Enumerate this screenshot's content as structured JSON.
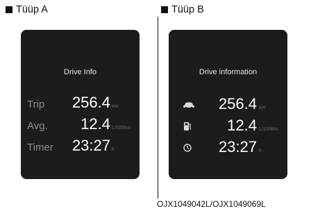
{
  "sections": {
    "a": {
      "title": "Tüüp A"
    },
    "b": {
      "title": "Tüüp B"
    }
  },
  "screen_a": {
    "title": "Drive Info",
    "rows": [
      {
        "label": "Trip",
        "value": "256.4",
        "unit": "km"
      },
      {
        "label": "Avg.",
        "value": "12.4",
        "unit": "L/100km"
      },
      {
        "label": "Timer",
        "value": "23:27",
        "unit": "h"
      }
    ]
  },
  "screen_b": {
    "title": "Drive information",
    "rows": [
      {
        "icon": "car-icon",
        "value": "256.4",
        "unit": "km"
      },
      {
        "icon": "fuel-pump-icon",
        "value": "12.4",
        "unit": "L/100km"
      },
      {
        "icon": "clock-icon",
        "value": "23:27",
        "unit": "h"
      }
    ]
  },
  "caption": "OJX1049042L/OJX1049069L"
}
